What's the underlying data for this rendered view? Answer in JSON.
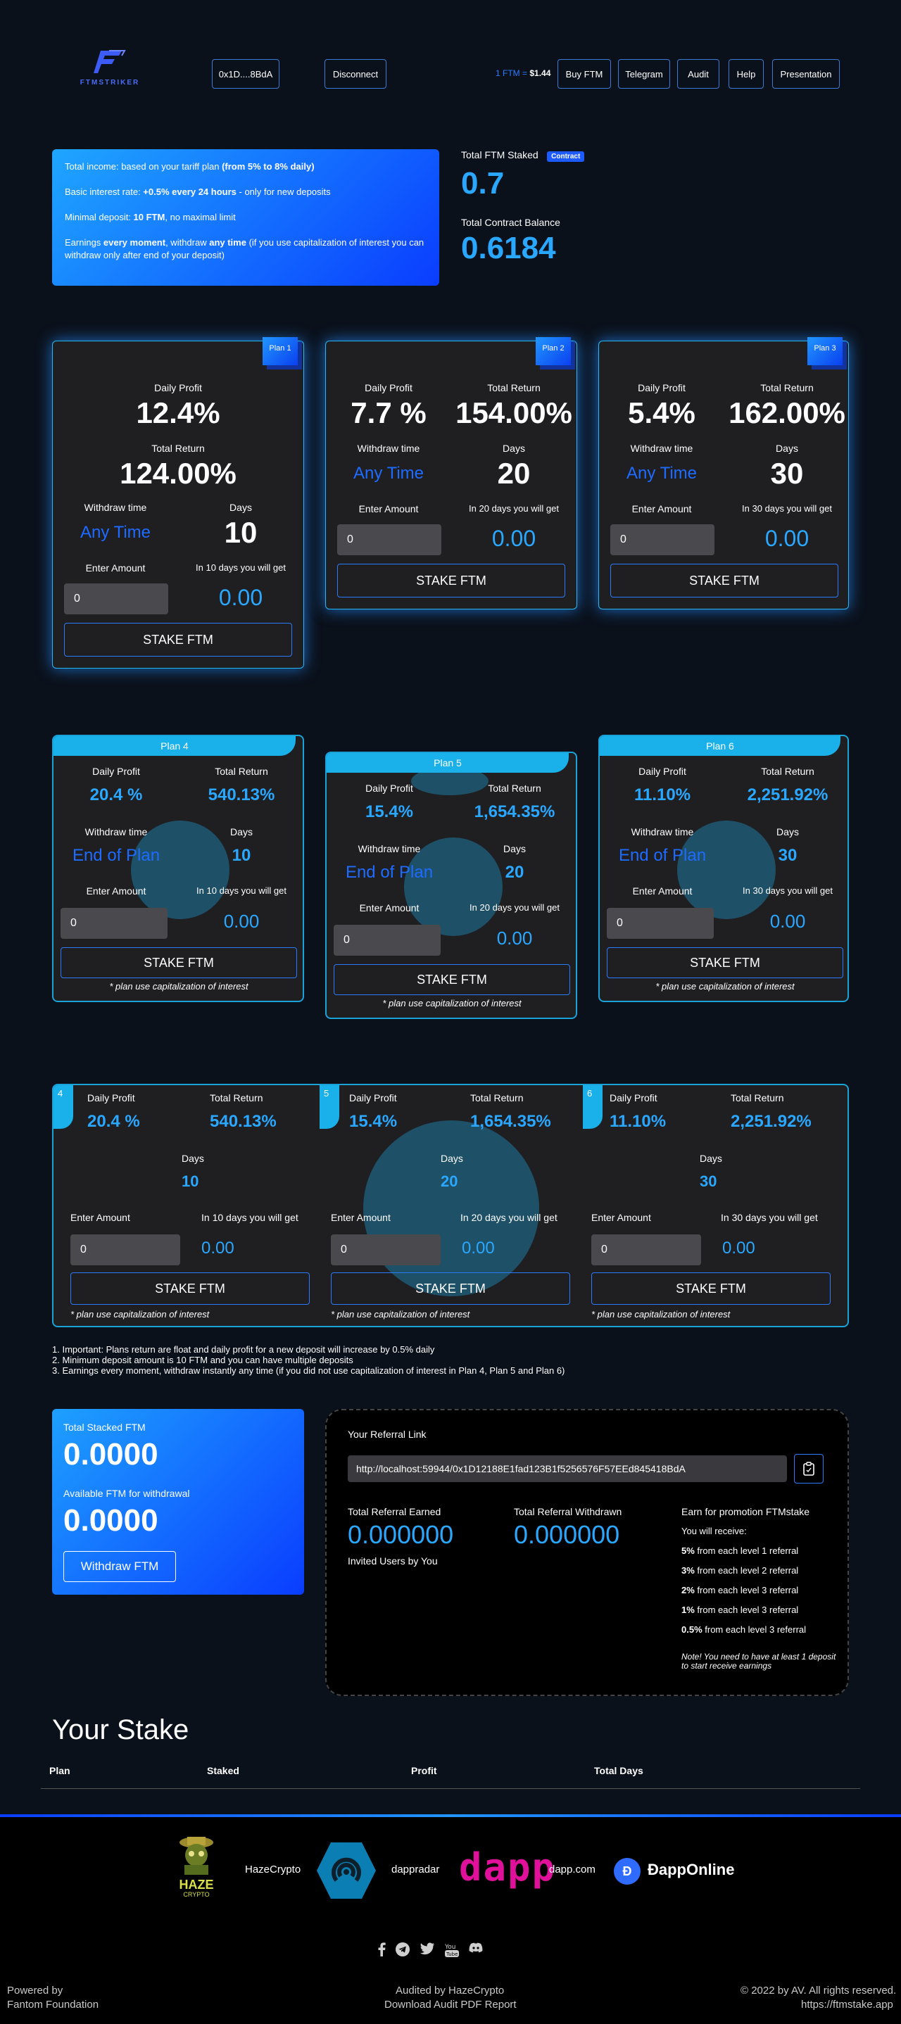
{
  "header": {
    "brand": "FTMSTRIKER",
    "wallet": "0x1D....8BdA",
    "disconnect": "Disconnect",
    "price_label": "1 FTM =",
    "price_value": "$1.44",
    "nav": [
      "Buy FTM",
      "Telegram",
      "Audit",
      "Help",
      "Presentation"
    ]
  },
  "info": {
    "line1_pre": "Total income: based on your tariff plan ",
    "line1_bold": "(from 5% to 8% daily)",
    "line2_pre": "Basic interest rate: ",
    "line2_bold": "+0.5% every 24 hours",
    "line2_post": " - only for new deposits",
    "line3_pre": "Minimal deposit: ",
    "line3_bold": "10 FTM",
    "line3_post": ", no maximal limit",
    "line4_pre": "Earnings ",
    "line4_bold1": "every moment",
    "line4_mid": ", withdraw ",
    "line4_bold2": "any time",
    "line4_post": " (if you use capitalization of interest you can withdraw only after end of your deposit)"
  },
  "stats": {
    "staked_label": "Total FTM Staked",
    "contract_badge": "Contract",
    "staked_value": "0.7",
    "balance_label": "Total Contract Balance",
    "balance_value": "0.6184"
  },
  "labels": {
    "daily_profit": "Daily Profit",
    "total_return": "Total Return",
    "withdraw_time": "Withdraw time",
    "days": "Days",
    "enter_amount": "Enter Amount",
    "stake_button": "STAKE FTM",
    "cap_note": "* plan use capitalization of interest"
  },
  "plans": [
    {
      "tag": "Plan 1",
      "daily": "12.4%",
      "total": "124.00%",
      "withdraw": "Any Time",
      "days": "10",
      "get_label": "In 10 days you will get",
      "input": "0",
      "get": "0.00"
    },
    {
      "tag": "Plan 2",
      "daily": "7.7 %",
      "total": "154.00%",
      "withdraw": "Any Time",
      "days": "20",
      "get_label": "In 20 days you will get",
      "input": "0",
      "get": "0.00"
    },
    {
      "tag": "Plan 3",
      "daily": "5.4%",
      "total": "162.00%",
      "withdraw": "Any Time",
      "days": "30",
      "get_label": "In 30 days you will get",
      "input": "0",
      "get": "0.00"
    }
  ],
  "cap_plans": [
    {
      "tag": "Plan 4",
      "daily": "20.4 %",
      "total": "540.13%",
      "withdraw": "End of Plan",
      "days": "10",
      "get_label": "In 10 days you will get",
      "input": "0",
      "get": "0.00"
    },
    {
      "tag": "Plan 5",
      "daily": "15.4%",
      "total": "1,654.35%",
      "withdraw": "End of Plan",
      "days": "20",
      "get_label": "In 20 days you will get",
      "input": "0",
      "get": "0.00"
    },
    {
      "tag": "Plan 6",
      "daily": "11.10%",
      "total": "2,251.92%",
      "withdraw": "End of Plan",
      "days": "30",
      "get_label": "In 30 days you will get",
      "input": "0",
      "get": "0.00"
    }
  ],
  "wide_plans": [
    {
      "tag": "4",
      "daily": "20.4 %",
      "total": "540.13%",
      "days": "10",
      "get_label": "In 10 days you will get",
      "input": "0",
      "get": "0.00"
    },
    {
      "tag": "5",
      "daily": "15.4%",
      "total": "1,654.35%",
      "days": "20",
      "get_label": "In 20 days you will get",
      "input": "0",
      "get": "0.00"
    },
    {
      "tag": "6",
      "daily": "11.10%",
      "total": "2,251.92%",
      "days": "30",
      "get_label": "In 30 days you will get",
      "input": "0",
      "get": "0.00"
    }
  ],
  "notes": [
    "1. Important: Plans return are float and daily profit for a new deposit will increase by 0.5% daily",
    "2. Minimum deposit amount is 10 FTM and you can have multiple deposits",
    "3. Earnings every moment, withdraw instantly any time (if you did not use capitalization of interest in Plan 4, Plan 5 and Plan 6)"
  ],
  "stacked": {
    "total_label": "Total Stacked FTM",
    "total_value": "0.0000",
    "avail_label": "Available FTM for withdrawal",
    "avail_value": "0.0000",
    "withdraw_button": "Withdraw FTM"
  },
  "referral": {
    "link_label": "Your Referral Link",
    "link": "http://localhost:59944/0x1D12188E1fad123B1f5256576F57EEd845418BdA",
    "earned_label": "Total Referral Earned",
    "earned_value": "0.000000",
    "withdrawn_label": "Total Referral Withdrawn",
    "withdrawn_value": "0.000000",
    "invited_label": "Invited Users by You",
    "promo_title": "Earn for promotion FTMstake",
    "promo_receive": "You will receive:",
    "levels": [
      {
        "pct": "5%",
        "text": " from each level 1 referral"
      },
      {
        "pct": "3%",
        "text": " from each level 2 referral"
      },
      {
        "pct": "2%",
        "text": " from each level 3 referral"
      },
      {
        "pct": "1%",
        "text": " from each level 3 referral"
      },
      {
        "pct": "0.5%",
        "text": " from each level 3 referral"
      }
    ],
    "note": "Note! You need to have at least 1 deposit to start receive earnings"
  },
  "your_stake": {
    "title": "Your Stake",
    "columns": [
      "Plan",
      "Staked",
      "Profit",
      "Total Days"
    ]
  },
  "partners": {
    "haze_logo_text": "HAZE",
    "haze_logo_sub": "CRYPTO",
    "haze": "HazeCrypto",
    "dappradar": "dappradar",
    "dapp_logo": "dapp",
    "dappcom": "dapp.com",
    "dapponline": "ĐappOnline"
  },
  "footer": {
    "powered_by": "Powered by",
    "fantom": "Fantom Foundation",
    "audited": "Audited by HazeCrypto",
    "download": "Download Audit PDF Report",
    "copyright": "© 2022 by AV. All rights reserved.",
    "site": "https://ftmstake.app",
    "socials": [
      "facebook-icon",
      "telegram-icon",
      "twitter-icon",
      "youtube-icon",
      "discord-icon"
    ]
  },
  "colors": {
    "accent": "#2aa8ff",
    "brand_blue": "#0a3dff",
    "card_bg": "#1f1f22",
    "cyan": "#1ab0ea"
  }
}
